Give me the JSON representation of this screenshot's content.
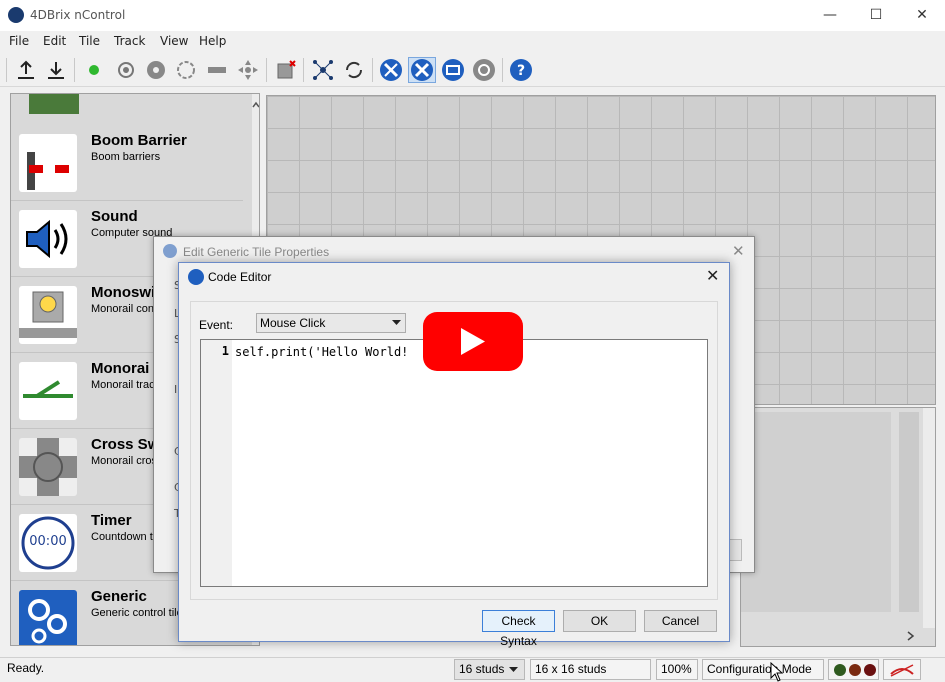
{
  "app": {
    "title": "4DBrix nControl"
  },
  "window_controls": {
    "minimize": "—",
    "maximize": "☐",
    "close": "✕"
  },
  "menu": [
    "File",
    "Edit",
    "Tile",
    "Track",
    "View",
    "Help"
  ],
  "toolbar_icons": [
    "upload-icon",
    "download-icon",
    "green-dot-icon",
    "target-icon",
    "fan-icon",
    "loop-icon",
    "rail-icon",
    "move-icon",
    "delete-tile-icon",
    "network-icon",
    "refresh-icon",
    "tools-icon",
    "wrench-icon",
    "screen-icon",
    "gear-icon",
    "help-icon"
  ],
  "palette": [
    {
      "title": "Boom Barrier",
      "subtitle": "Boom barriers",
      "icon": "boom-barrier-icon"
    },
    {
      "title": "Sound",
      "subtitle": "Computer sound",
      "icon": "speaker-icon"
    },
    {
      "title": "Monoswi",
      "subtitle": "Monorail cont",
      "icon": "monorail-switch-icon"
    },
    {
      "title": "Monorai",
      "subtitle": "Monorail track",
      "icon": "monorail-track-icon"
    },
    {
      "title": "Cross Sw",
      "subtitle": "Monorail cros",
      "icon": "cross-switch-icon"
    },
    {
      "title": "Timer",
      "subtitle": "Countdown ti",
      "icon": "timer-icon",
      "display": "00:00"
    },
    {
      "title": "Generic",
      "subtitle": "Generic control tile",
      "icon": "gears-icon"
    }
  ],
  "outer_dialog": {
    "title": "Edit Generic Tile Properties",
    "left_letters": [
      "S",
      "L",
      "S",
      "I",
      "C",
      "C",
      "T"
    ]
  },
  "code_editor": {
    "title": "Code Editor",
    "event_label": "Event:",
    "event_value": "Mouse Click",
    "line_number": "1",
    "code": "self.print('Hello World!",
    "buttons": {
      "check": "Check Syntax",
      "ok": "OK",
      "cancel": "Cancel"
    }
  },
  "status": {
    "ready": "Ready.",
    "studs": "16 studs",
    "grid": "16 x 16 studs",
    "zoom": "100%",
    "mode": "Configuration Mode"
  },
  "colors": {
    "accent": "#1f5fbf",
    "video_overlay": "#ff0000"
  }
}
